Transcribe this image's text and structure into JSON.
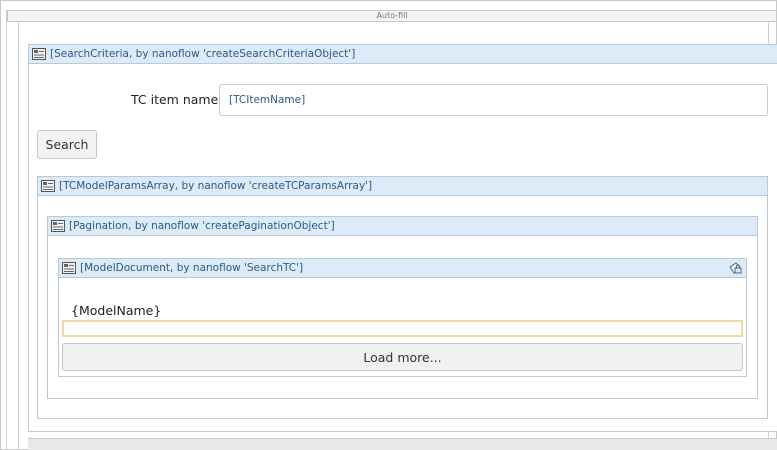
{
  "autofill": {
    "label": "Auto-fill"
  },
  "search_criteria": {
    "title": "[SearchCriteria, by nanoflow 'createSearchCriteriaObject']",
    "field_label": "TC item name",
    "field_value": "[TCItemName]",
    "search_button": "Search"
  },
  "tc_params": {
    "title": "[TCModelParamsArray, by nanoflow 'createTCParamsArray']"
  },
  "pagination": {
    "title": "[Pagination, by nanoflow 'createPaginationObject']"
  },
  "model_document": {
    "title": "[ModelDocument, by nanoflow 'SearchTC']",
    "model_name": "{ModelName}",
    "load_more_button": "Load more..."
  },
  "icons": {
    "dataview": "dataview-icon",
    "lock": "lock-icon"
  },
  "colors": {
    "header_bg": "#dcebf7",
    "header_text": "#2b5b87",
    "highlight_border": "#f3d8a8"
  }
}
